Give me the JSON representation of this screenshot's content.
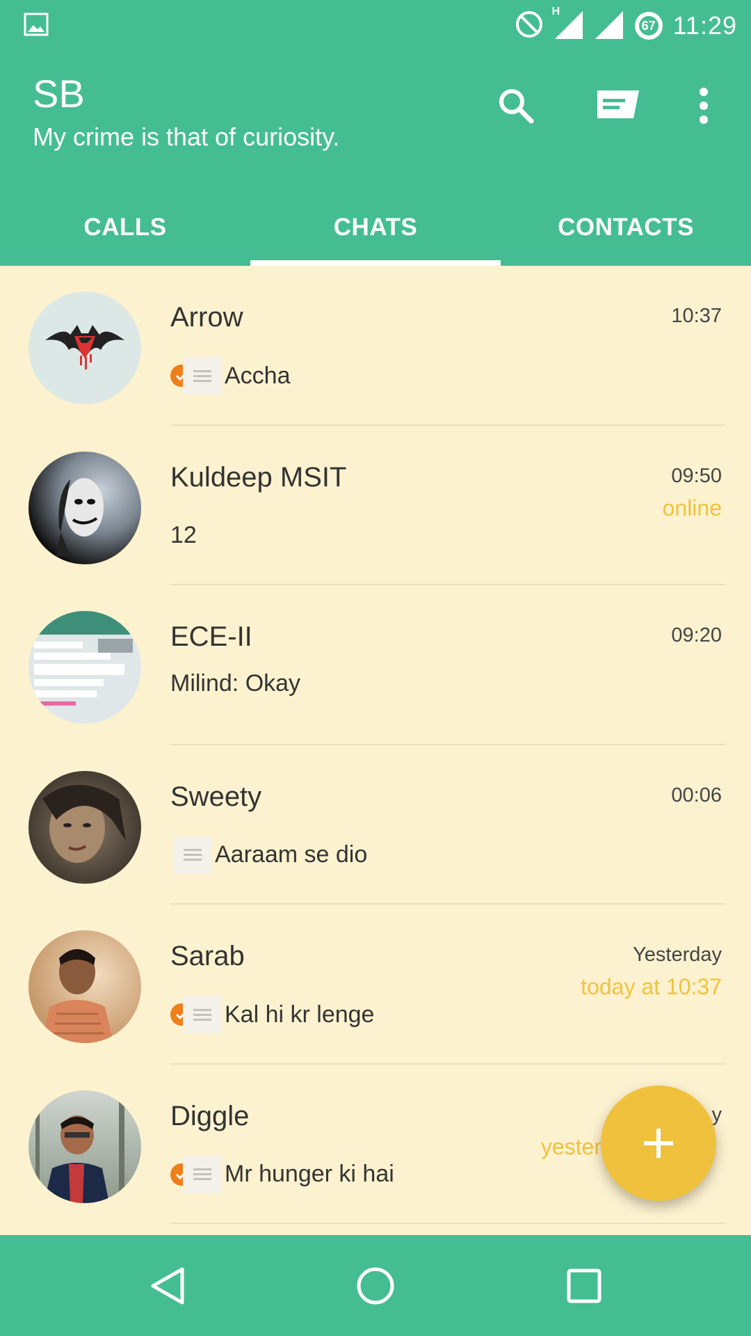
{
  "status_bar": {
    "time": "11:29",
    "battery": "67",
    "network": "H",
    "icons": [
      "gallery-icon",
      "do-not-disturb-icon",
      "signal-icon",
      "battery-icon"
    ]
  },
  "header": {
    "title": "SB",
    "subtitle": "My crime is that of curiosity.",
    "actions": [
      "search-icon",
      "new-message-icon",
      "more-vert-icon"
    ]
  },
  "tabs": [
    {
      "label": "CALLS",
      "active": false
    },
    {
      "label": "CHATS",
      "active": true
    },
    {
      "label": "CONTACTS",
      "active": false
    }
  ],
  "chats": [
    {
      "name": "Arrow",
      "time": "10:37",
      "status": "",
      "message": "Accha",
      "delivered": true,
      "message_icon": true
    },
    {
      "name": "Kuldeep MSIT",
      "time": "09:50",
      "status": "online",
      "message": "12",
      "delivered": false,
      "message_icon": false
    },
    {
      "name": "ECE-II",
      "time": "09:20",
      "status": "",
      "message": "Milind:  Okay",
      "delivered": false,
      "message_icon": false
    },
    {
      "name": "Sweety",
      "time": "00:06",
      "status": "",
      "message": "Aaraam se dio",
      "delivered": false,
      "message_icon": true
    },
    {
      "name": "Sarab",
      "time": "Yesterday",
      "status": "today at 10:37",
      "message": "Kal hi kr lenge",
      "delivered": true,
      "message_icon": true
    },
    {
      "name": "Diggle",
      "time": "y",
      "status": "yester",
      "message": "Mr hunger ki hai",
      "delivered": true,
      "message_icon": true
    }
  ],
  "fab": {
    "icon": "plus-icon"
  },
  "nav": [
    "back-icon",
    "home-icon",
    "recents-icon"
  ],
  "colors": {
    "primary": "#45bd92",
    "background": "#fdf2cf",
    "accent": "#f0c13c",
    "check": "#ee7f1a"
  }
}
